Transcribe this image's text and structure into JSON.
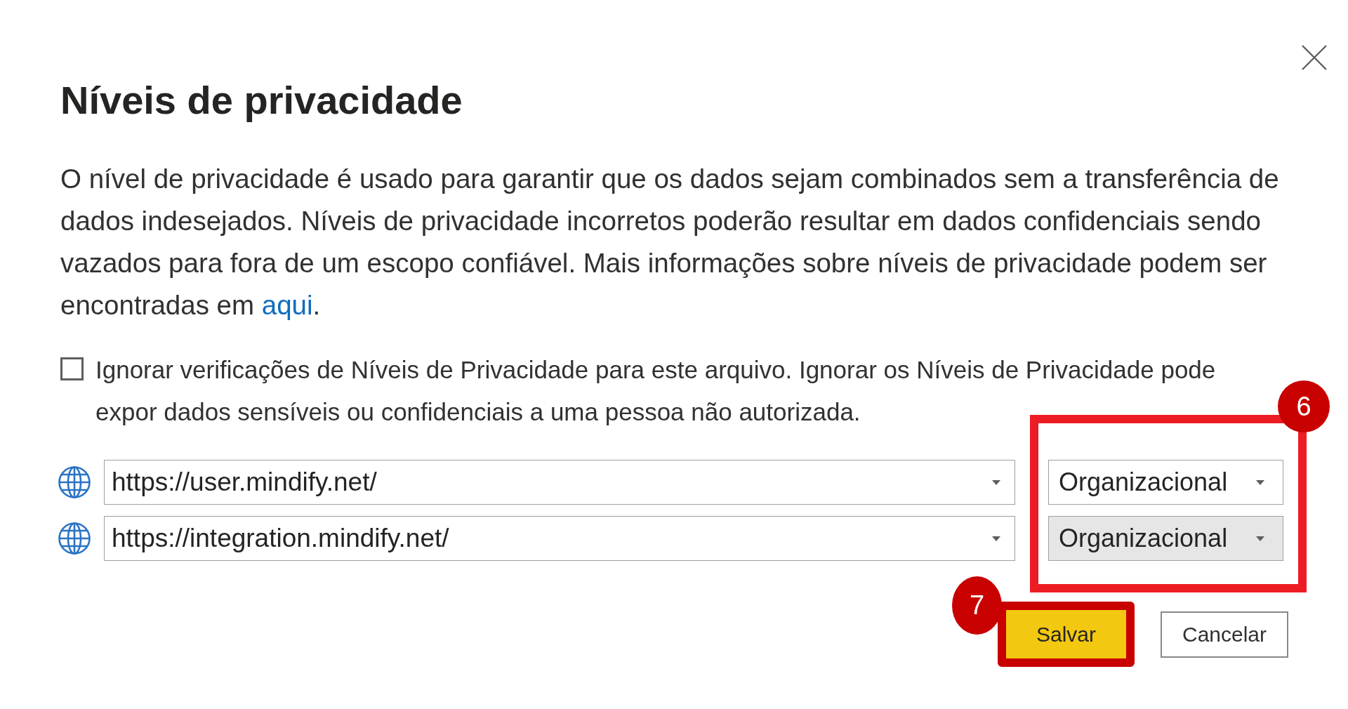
{
  "dialog": {
    "title": "Níveis de privacidade",
    "description": {
      "text": "O nível de privacidade é usado para garantir que os dados sejam combinados sem a transferência de dados indesejados. Níveis de privacidade incorretos poderão resultar em dados confidenciais sendo vazados para fora de um escopo confiável. Mais informações sobre níveis de privacidade podem ser encontradas em",
      "link": "aqui",
      "after": "."
    },
    "checkbox": {
      "label": "Ignorar verificações de Níveis de Privacidade para este arquivo. Ignorar os Níveis de Privacidade pode expor dados sensíveis ou confidenciais a uma pessoa não autorizada.",
      "checked": false
    },
    "sources": {
      "callout": "6",
      "rows": [
        {
          "url": "https://user.mindify.net/",
          "privacy": {
            "value": "Organizacional",
            "hovered": false
          }
        },
        {
          "url": "https://integration.mindify.net/",
          "privacy": {
            "value": "Organizacional",
            "hovered": true
          }
        }
      ]
    },
    "buttons": [
      {
        "label": "Salvar",
        "kind": "primary",
        "callout": "7"
      },
      {
        "label": "Cancelar",
        "kind": "secondary"
      }
    ]
  }
}
